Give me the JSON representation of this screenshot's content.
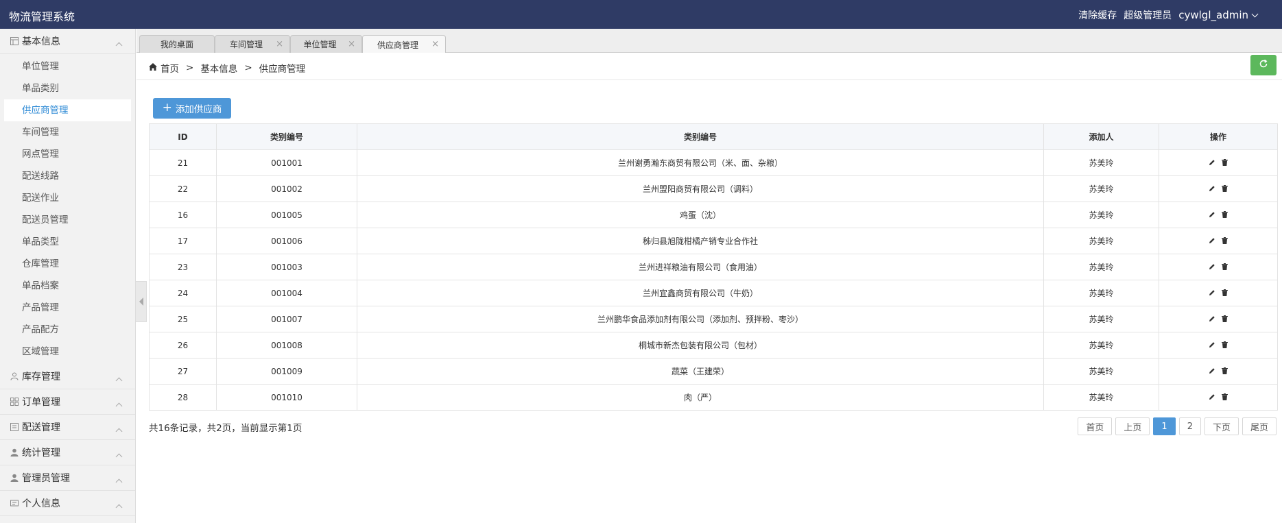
{
  "header": {
    "app_title": "物流管理系统",
    "clear_cache": "清除缓存",
    "role": "超级管理员",
    "username": "cywlgl_admin"
  },
  "sidebar": {
    "groups": [
      {
        "label": "基本信息",
        "icon": "grid-icon",
        "expanded": true,
        "items": [
          "单位管理",
          "单品类别",
          "供应商管理",
          "车间管理",
          "网点管理",
          "配送线路",
          "配送作业",
          "配送员管理",
          "单品类型",
          "仓库管理",
          "单品档案",
          "产品管理",
          "产品配方",
          "区域管理"
        ],
        "active_item": "供应商管理"
      },
      {
        "label": "库存管理",
        "icon": "user-icon"
      },
      {
        "label": "订单管理",
        "icon": "apps-icon"
      },
      {
        "label": "配送管理",
        "icon": "building-icon"
      },
      {
        "label": "统计管理",
        "icon": "user-icon"
      },
      {
        "label": "管理员管理",
        "icon": "user-icon"
      },
      {
        "label": "个人信息",
        "icon": "card-icon"
      }
    ]
  },
  "tabs": [
    {
      "label": "我的桌面",
      "closable": false
    },
    {
      "label": "车间管理",
      "closable": true
    },
    {
      "label": "单位管理",
      "closable": true
    },
    {
      "label": "供应商管理",
      "closable": true,
      "active": true
    }
  ],
  "breadcrumb": {
    "home": "首页",
    "level1": "基本信息",
    "level2": "供应商管理",
    "separator": ">"
  },
  "add_button": "添加供应商",
  "table": {
    "headers": [
      "ID",
      "类别编号",
      "类别编号",
      "添加人",
      "操作"
    ],
    "rows": [
      [
        "21",
        "001001",
        "兰州谢勇瀚东商贸有限公司（米、面、杂粮）",
        "苏美玲"
      ],
      [
        "22",
        "001002",
        "兰州盟阳商贸有限公司（调料）",
        "苏美玲"
      ],
      [
        "16",
        "001005",
        "鸡蛋（沈）",
        "苏美玲"
      ],
      [
        "17",
        "001006",
        "秭归县旭陇柑橘产销专业合作社",
        "苏美玲"
      ],
      [
        "23",
        "001003",
        "兰州进祥粮油有限公司（食用油）",
        "苏美玲"
      ],
      [
        "24",
        "001004",
        "兰州宜鑫商贸有限公司（牛奶）",
        "苏美玲"
      ],
      [
        "25",
        "001007",
        "兰州鹏华食品添加剂有限公司（添加剂、预拌粉、枣沙）",
        "苏美玲"
      ],
      [
        "26",
        "001008",
        "桐城市新杰包装有限公司（包材）",
        "苏美玲"
      ],
      [
        "27",
        "001009",
        "蔬菜（王建荣）",
        "苏美玲"
      ],
      [
        "28",
        "001010",
        "肉（严）",
        "苏美玲"
      ]
    ]
  },
  "footer": {
    "summary": "共16条记录，共2页，当前显示第1页",
    "pager": [
      "首页",
      "上页",
      "1",
      "2",
      "下页",
      "尾页"
    ],
    "current_page": "1"
  },
  "colors": {
    "header_bg": "#2f3b65",
    "primary": "#4e97d8",
    "refresh": "#5cb85c",
    "active_nav": "#2f8bd6"
  }
}
